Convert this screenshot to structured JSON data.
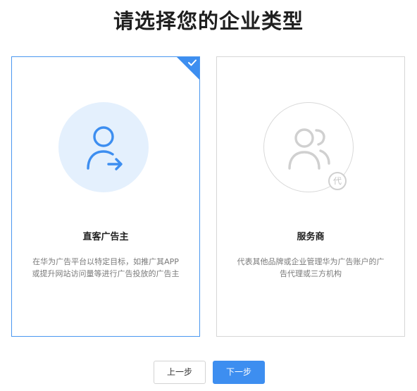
{
  "page": {
    "title": "请选择您的企业类型"
  },
  "cards": [
    {
      "title": "直客广告主",
      "desc_line1": "在华为广告平台以特定目标，如推广其APP",
      "desc_line2": "或提升网站访问量等进行广告投放的广告主",
      "selected": true,
      "icon": "user-arrow-icon"
    },
    {
      "title": "服务商",
      "desc_line1": "代表其他品牌或企业管理华为广告账户的广",
      "desc_line2": "告代理或三方机构",
      "selected": false,
      "icon": "users-agent-icon",
      "badge": "代"
    }
  ],
  "buttons": {
    "prev_label": "上一步",
    "next_label": "下一步"
  },
  "colors": {
    "accent": "#3d8ef0",
    "selected_circle": "#e4f0fd",
    "inactive_icon": "#d0d0d0"
  }
}
